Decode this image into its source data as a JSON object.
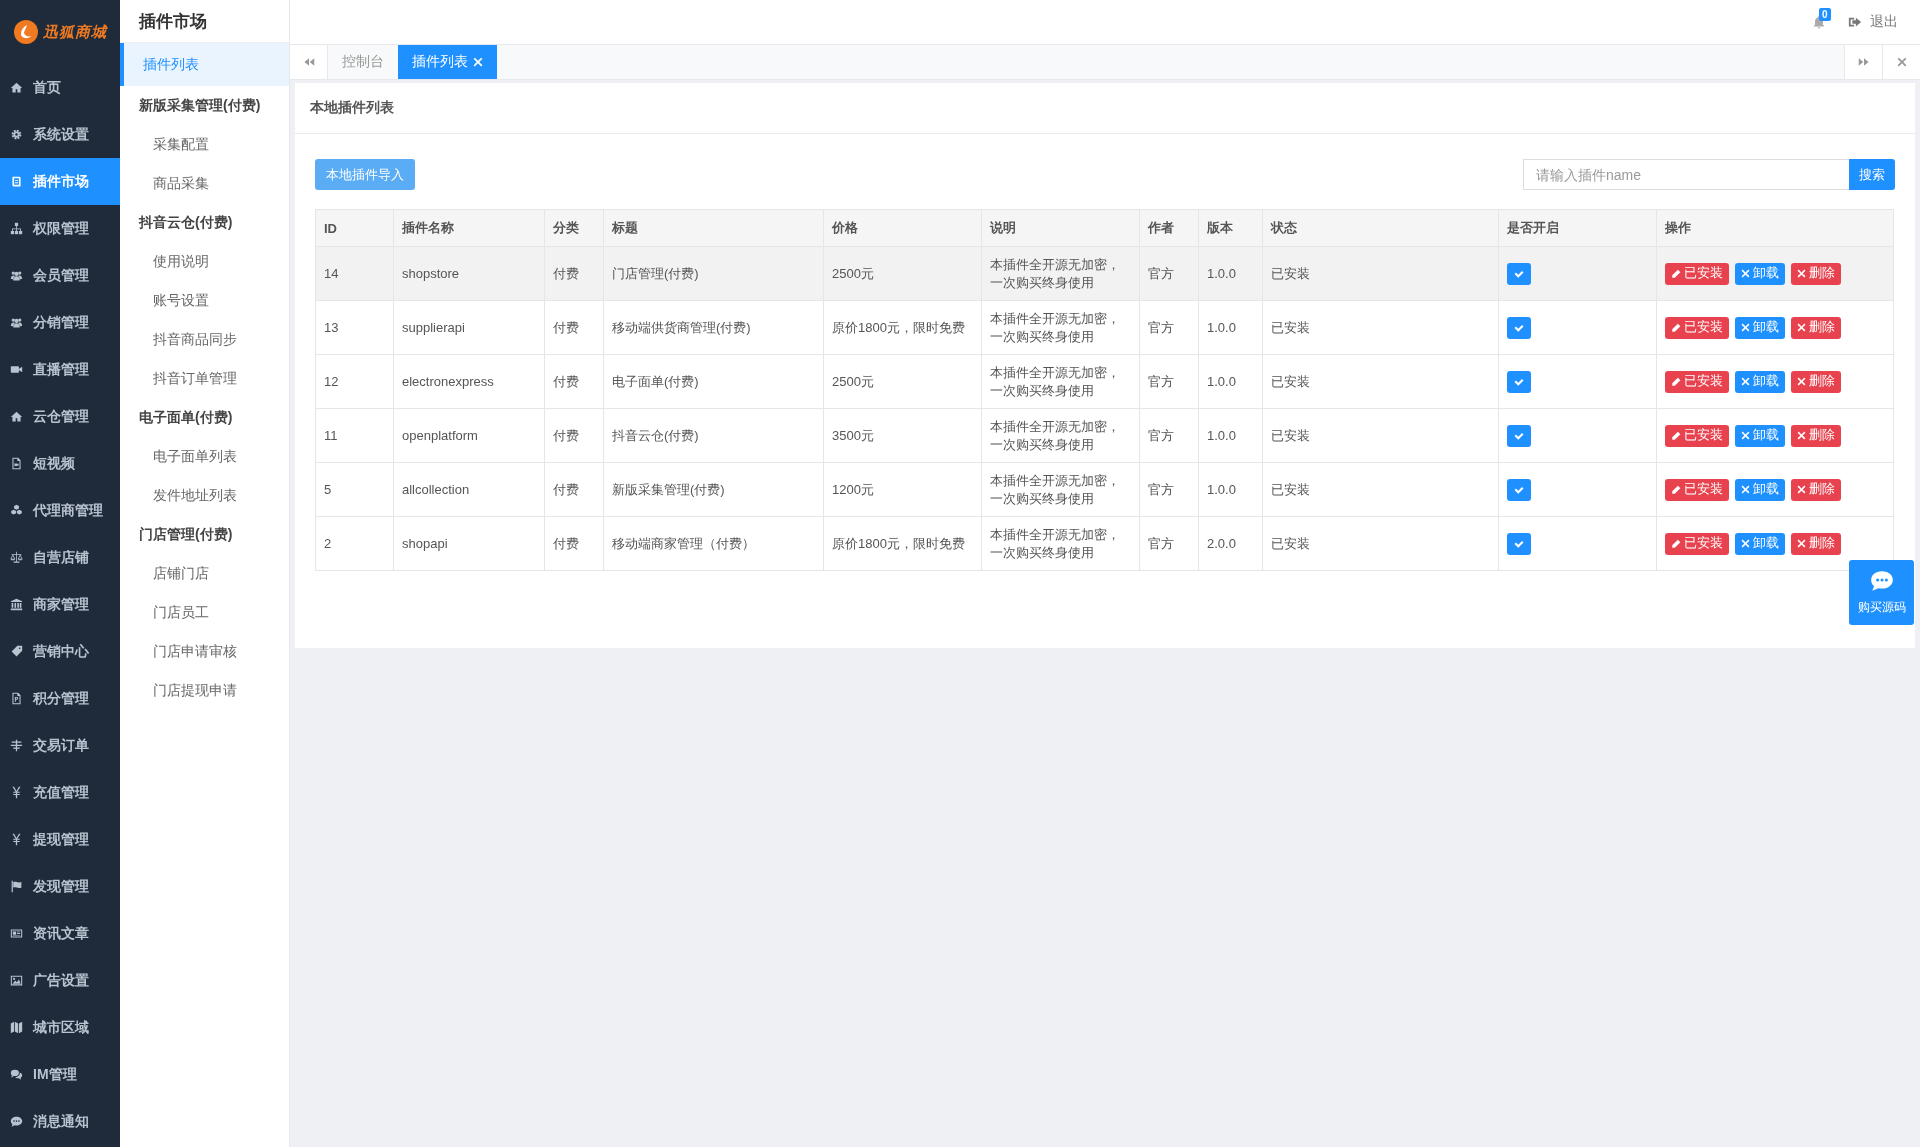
{
  "brand": {
    "name": "迅狐商城"
  },
  "header": {
    "notification_count": "0",
    "logout": "退出"
  },
  "sidebar": {
    "items": [
      {
        "label": "首页",
        "selected": false
      },
      {
        "label": "系统设置",
        "selected": false
      },
      {
        "label": "插件市场",
        "selected": true
      },
      {
        "label": "权限管理",
        "selected": false
      },
      {
        "label": "会员管理",
        "selected": false
      },
      {
        "label": "分销管理",
        "selected": false
      },
      {
        "label": "直播管理",
        "selected": false
      },
      {
        "label": "云仓管理",
        "selected": false
      },
      {
        "label": "短视频",
        "selected": false
      },
      {
        "label": "代理商管理",
        "selected": false
      },
      {
        "label": "自营店铺",
        "selected": false
      },
      {
        "label": "商家管理",
        "selected": false
      },
      {
        "label": "营销中心",
        "selected": false
      },
      {
        "label": "积分管理",
        "selected": false
      },
      {
        "label": "交易订单",
        "selected": false
      },
      {
        "label": "充值管理",
        "selected": false
      },
      {
        "label": "提现管理",
        "selected": false
      },
      {
        "label": "发现管理",
        "selected": false
      },
      {
        "label": "资讯文章",
        "selected": false
      },
      {
        "label": "广告设置",
        "selected": false
      },
      {
        "label": "城市区域",
        "selected": false
      },
      {
        "label": "IM管理",
        "selected": false
      },
      {
        "label": "消息通知",
        "selected": false
      }
    ]
  },
  "submenu": {
    "title": "插件市场",
    "items": [
      {
        "label": "插件列表",
        "kind": "link",
        "selected": true
      },
      {
        "label": "新版采集管理(付费)",
        "kind": "heading"
      },
      {
        "label": "采集配置",
        "kind": "link",
        "selected": false
      },
      {
        "label": "商品采集",
        "kind": "link",
        "selected": false
      },
      {
        "label": "抖音云仓(付费)",
        "kind": "heading"
      },
      {
        "label": "使用说明",
        "kind": "link",
        "selected": false
      },
      {
        "label": "账号设置",
        "kind": "link",
        "selected": false
      },
      {
        "label": "抖音商品同步",
        "kind": "link",
        "selected": false
      },
      {
        "label": "抖音订单管理",
        "kind": "link",
        "selected": false
      },
      {
        "label": "电子面单(付费)",
        "kind": "heading"
      },
      {
        "label": "电子面单列表",
        "kind": "link",
        "selected": false
      },
      {
        "label": "发件地址列表",
        "kind": "link",
        "selected": false
      },
      {
        "label": "门店管理(付费)",
        "kind": "heading"
      },
      {
        "label": "店铺门店",
        "kind": "link",
        "selected": false
      },
      {
        "label": "门店员工",
        "kind": "link",
        "selected": false
      },
      {
        "label": "门店申请审核",
        "kind": "link",
        "selected": false
      },
      {
        "label": "门店提现申请",
        "kind": "link",
        "selected": false
      }
    ]
  },
  "tabs": [
    {
      "label": "控制台",
      "selected": false,
      "closable": false
    },
    {
      "label": "插件列表",
      "selected": true,
      "closable": true
    }
  ],
  "panel": {
    "title": "本地插件列表",
    "import_button": "本地插件导入",
    "search": {
      "placeholder": "请输入插件name",
      "button": "搜索"
    }
  },
  "table": {
    "columns": [
      "ID",
      "插件名称",
      "分类",
      "标题",
      "价格",
      "说明",
      "作者",
      "版本",
      "状态",
      "是否开启",
      "操作"
    ],
    "rows": [
      {
        "cells": [
          "14",
          "shopstore",
          "付费",
          "门店管理(付费)",
          "2500元",
          "本插件全开源无加密，一次购买终身使用",
          "官方",
          "1.0.0",
          "已安装"
        ],
        "highlighted": true,
        "enabled": true,
        "actions": [
          {
            "label": "已安装",
            "kind": "edit"
          },
          {
            "label": "卸载",
            "kind": "uninstall"
          },
          {
            "label": "删除",
            "kind": "delete"
          }
        ]
      },
      {
        "cells": [
          "13",
          "supplierapi",
          "付费",
          "移动端供货商管理(付费)",
          "原价1800元，限时免费",
          "本插件全开源无加密，一次购买终身使用",
          "官方",
          "1.0.0",
          "已安装"
        ],
        "highlighted": false,
        "enabled": true,
        "actions": [
          {
            "label": "已安装",
            "kind": "edit"
          },
          {
            "label": "卸载",
            "kind": "uninstall"
          },
          {
            "label": "删除",
            "kind": "delete"
          }
        ]
      },
      {
        "cells": [
          "12",
          "electronexpress",
          "付费",
          "电子面单(付费)",
          "2500元",
          "本插件全开源无加密，一次购买终身使用",
          "官方",
          "1.0.0",
          "已安装"
        ],
        "highlighted": false,
        "enabled": true,
        "actions": [
          {
            "label": "已安装",
            "kind": "edit"
          },
          {
            "label": "卸载",
            "kind": "uninstall"
          },
          {
            "label": "删除",
            "kind": "delete"
          }
        ]
      },
      {
        "cells": [
          "11",
          "openplatform",
          "付费",
          "抖音云仓(付费)",
          "3500元",
          "本插件全开源无加密，一次购买终身使用",
          "官方",
          "1.0.0",
          "已安装"
        ],
        "highlighted": false,
        "enabled": true,
        "actions": [
          {
            "label": "已安装",
            "kind": "edit"
          },
          {
            "label": "卸载",
            "kind": "uninstall"
          },
          {
            "label": "删除",
            "kind": "delete"
          }
        ]
      },
      {
        "cells": [
          "5",
          "allcollection",
          "付费",
          "新版采集管理(付费)",
          "1200元",
          "本插件全开源无加密，一次购买终身使用",
          "官方",
          "1.0.0",
          "已安装"
        ],
        "highlighted": false,
        "enabled": true,
        "actions": [
          {
            "label": "已安装",
            "kind": "edit"
          },
          {
            "label": "卸载",
            "kind": "uninstall"
          },
          {
            "label": "删除",
            "kind": "delete"
          }
        ]
      },
      {
        "cells": [
          "2",
          "shopapi",
          "付费",
          "移动端商家管理（付费）",
          "原价1800元，限时免费",
          "本插件全开源无加密，一次购买终身使用",
          "官方",
          "2.0.0",
          "已安装"
        ],
        "highlighted": false,
        "enabled": true,
        "actions": [
          {
            "label": "已安装",
            "kind": "edit"
          },
          {
            "label": "卸载",
            "kind": "uninstall"
          },
          {
            "label": "删除",
            "kind": "delete"
          }
        ]
      }
    ]
  },
  "float_button": {
    "label": "购买源码"
  }
}
